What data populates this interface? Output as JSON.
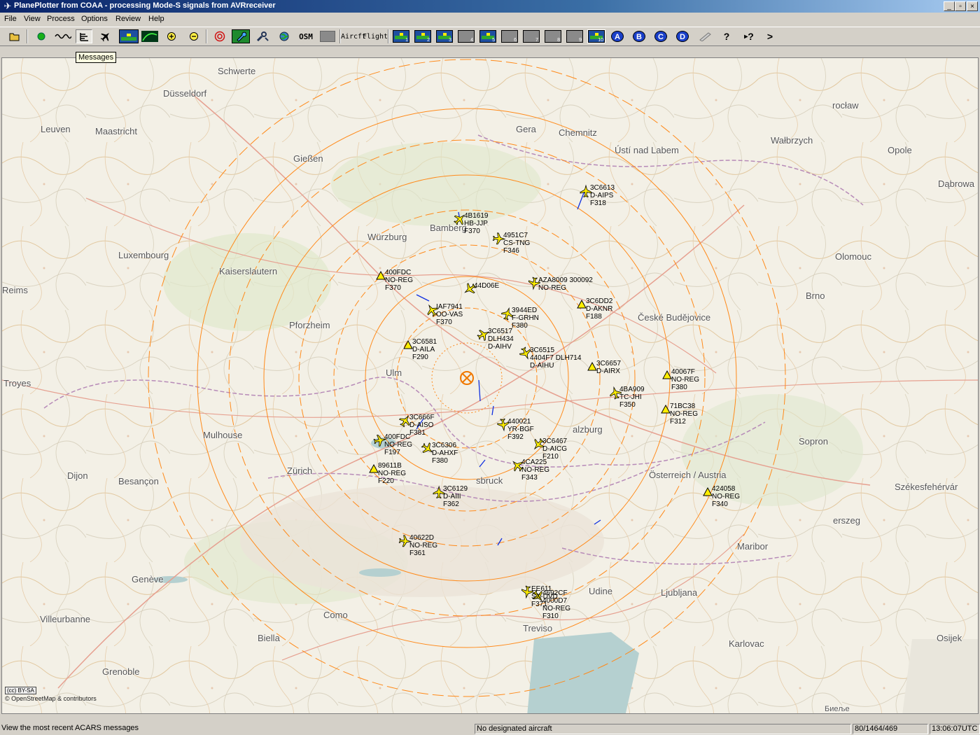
{
  "window": {
    "title": "PlanePlotter from COAA - processing Mode-S signals from AVRreceiver",
    "controls": [
      "_",
      "▫",
      "×"
    ]
  },
  "menu": [
    "File",
    "View",
    "Process",
    "Options",
    "Review",
    "Help"
  ],
  "toolbar": {
    "osm_label": "OSM",
    "aircraft_label": "Aircft",
    "flight_label": "Flight",
    "layers": [
      "1",
      "2",
      "3",
      "4",
      "5",
      "6",
      "7",
      "8",
      "9",
      "10"
    ],
    "circles": [
      "A",
      "B",
      "C",
      "D"
    ],
    "help_label": "?",
    "context_help_label": "?",
    "more_label": ">"
  },
  "tooltip": "Messages",
  "map": {
    "credit": "© OpenStreetMap & contributors",
    "license": "(cc) BY-SA",
    "cities": [
      {
        "name": "Schwerte"
      },
      {
        "name": "Düsseldorf"
      },
      {
        "name": "Leuven"
      },
      {
        "name": "Maastricht"
      },
      {
        "name": "Gießen"
      },
      {
        "name": "Würzburg"
      },
      {
        "name": "Bamberg"
      },
      {
        "name": "Luxembourg"
      },
      {
        "name": "Kaiserslautern"
      },
      {
        "name": "Reims"
      },
      {
        "name": "Pforzheim"
      },
      {
        "name": "Troyes"
      },
      {
        "name": "Ulm"
      },
      {
        "name": "Mulhouse"
      },
      {
        "name": "Dijon"
      },
      {
        "name": "Besançon"
      },
      {
        "name": "Zürich"
      },
      {
        "name": "Genève"
      },
      {
        "name": "Villeurbanne"
      },
      {
        "name": "Grenoble"
      },
      {
        "name": "Biella"
      },
      {
        "name": "Como"
      },
      {
        "name": "Treviso"
      },
      {
        "name": "Udine"
      },
      {
        "name": "Ljubljana"
      },
      {
        "name": "Karlovac"
      },
      {
        "name": "Osijek"
      },
      {
        "name": "Maribor"
      },
      {
        "name": "Székesfehérvár"
      },
      {
        "name": "erszeg"
      },
      {
        "name": "Sopron"
      },
      {
        "name": "Österreich / Austria"
      },
      {
        "name": "České Budějovice"
      },
      {
        "name": "Brno"
      },
      {
        "name": "Olomouc"
      },
      {
        "name": "Opole"
      },
      {
        "name": "Dąbrowa"
      },
      {
        "name": "Wałbrzych"
      },
      {
        "name": "rocław"
      },
      {
        "name": "Ústí nad Labem"
      },
      {
        "name": "Chemnitz"
      },
      {
        "name": "Gera"
      },
      {
        "name": "alzburg"
      },
      {
        "name": "sbruck"
      },
      {
        "name": "Биеље"
      }
    ],
    "aircraft": [
      {
        "label": "3C6613\nD-AIPS\nF318"
      },
      {
        "label": "4B1619\nHB-JJP\nF370"
      },
      {
        "label": "4951C7\nCS-TNG\nF346"
      },
      {
        "label": "400FDC\nNO-REG\nF370"
      },
      {
        "label": "AZA8009 300092\nNO-REG"
      },
      {
        "label": "44D06E"
      },
      {
        "label": "3C6DD2\nD-AKNR\nF188"
      },
      {
        "label": "IAF7941\nOO-VAS\nF370"
      },
      {
        "label": "3944ED\nF-GRHN\nF380"
      },
      {
        "label": "3C6517\nDLH434\nD-AIHV"
      },
      {
        "label": "3C6581\nD-AILA\nF290"
      },
      {
        "label": "3C6515\n4404F7 DLH714\nD-AIHU"
      },
      {
        "label": "3C6657\nD-AIRX"
      },
      {
        "label": "40067F\nNO-REG\nF380"
      },
      {
        "label": "71BC38\nNO-REG\nF312"
      },
      {
        "label": "4BA909\nTC-JHI\nF350"
      },
      {
        "label": "3C666F\nD-AISO\nF381"
      },
      {
        "label": "400FDC\nNO-REG\nF197"
      },
      {
        "label": "3C6306\nD-AHXF\nF380"
      },
      {
        "label": "440021\nYR-BGF\nF392"
      },
      {
        "label": "3C6467\nD-AICG\nF210"
      },
      {
        "label": "89611B\nNO-REG\nF220"
      },
      {
        "label": "4CA225\nNO-REG\nF343"
      },
      {
        "label": "3C6129\nD-AIII\nF362"
      },
      {
        "label": "424058\nNO-REG\nF340"
      },
      {
        "label": "40622D\nNO-REG\nF361"
      },
      {
        "label": "4692CF\n4000D7\nNO-REG\nF310"
      },
      {
        "label": "EE611\nSX-DVD\nF371"
      }
    ]
  },
  "status": {
    "hint": "View the most recent ACARS messages",
    "designated": "No designated aircraft",
    "counts": "80/1464/469",
    "time": "13:06:07UTC"
  }
}
